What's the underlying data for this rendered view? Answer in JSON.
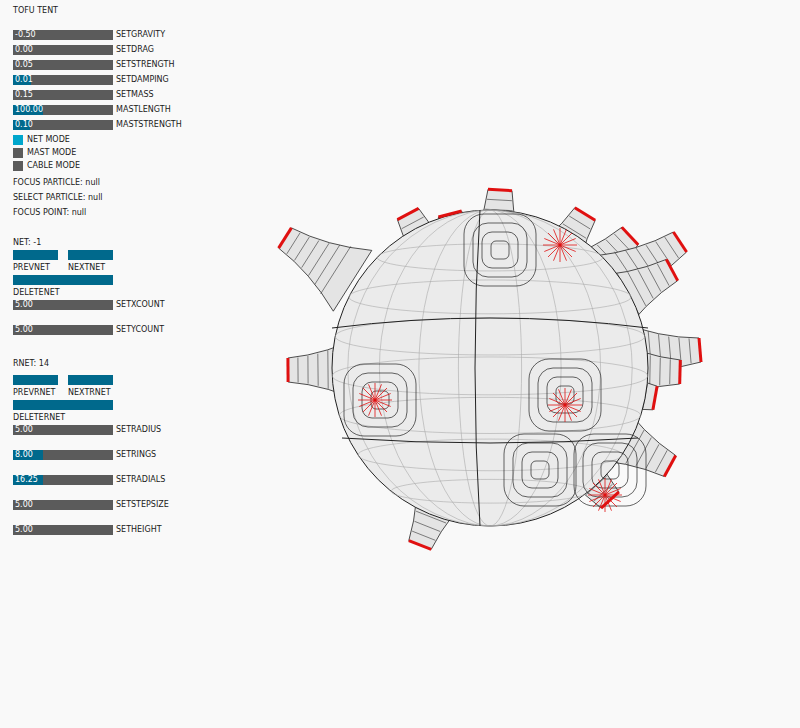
{
  "title": "TOFU TENT",
  "physics_sliders": [
    {
      "label": "SETGRAVITY",
      "value": "-0.50",
      "level": 0
    },
    {
      "label": "SETDRAG",
      "value": "0.00",
      "level": 0
    },
    {
      "label": "SETSTRENGTH",
      "value": "0.05",
      "level": 0
    },
    {
      "label": "SETDAMPING",
      "value": "0.01",
      "level": 0.18
    },
    {
      "label": "SETMASS",
      "value": "0.15",
      "level": 0
    },
    {
      "label": "MASTLENGTH",
      "value": "100.00",
      "level": 0.3
    },
    {
      "label": "MASTSTRENGTH",
      "value": "0.10",
      "level": 0.17
    }
  ],
  "modes": [
    {
      "label": "NET MODE",
      "on": true
    },
    {
      "label": "MAST MODE",
      "on": false
    },
    {
      "label": "CABLE MODE",
      "on": false
    }
  ],
  "status": [
    "FOCUS PARTICLE: null",
    "SELECT PARTICLE: null",
    "FOCUS POINT: null"
  ],
  "net": {
    "heading": "NET: -1",
    "buttons": [
      "PREVNET",
      "NEXTNET"
    ],
    "delete": "DELETENET",
    "sliders": [
      {
        "label": "SETXCOUNT",
        "value": "5.00",
        "level": 0
      },
      {
        "label": "SETYCOUNT",
        "value": "5.00",
        "level": 0
      }
    ]
  },
  "rnet": {
    "heading": "RNET: 14",
    "buttons": [
      "PREVRNET",
      "NEXTRNET"
    ],
    "delete": "DELETERNET",
    "sliders": [
      {
        "label": "SETRADIUS",
        "value": "5.00",
        "level": 0
      },
      {
        "label": "SETRINGS",
        "value": "8.00",
        "level": 0.3
      },
      {
        "label": "SETRADIALS",
        "value": "16.25",
        "level": 0.3
      },
      {
        "label": "SETSTEPSIZE",
        "value": "5.00",
        "level": 0
      },
      {
        "label": "SETHEIGHT",
        "value": "5.00",
        "level": 0
      }
    ]
  }
}
